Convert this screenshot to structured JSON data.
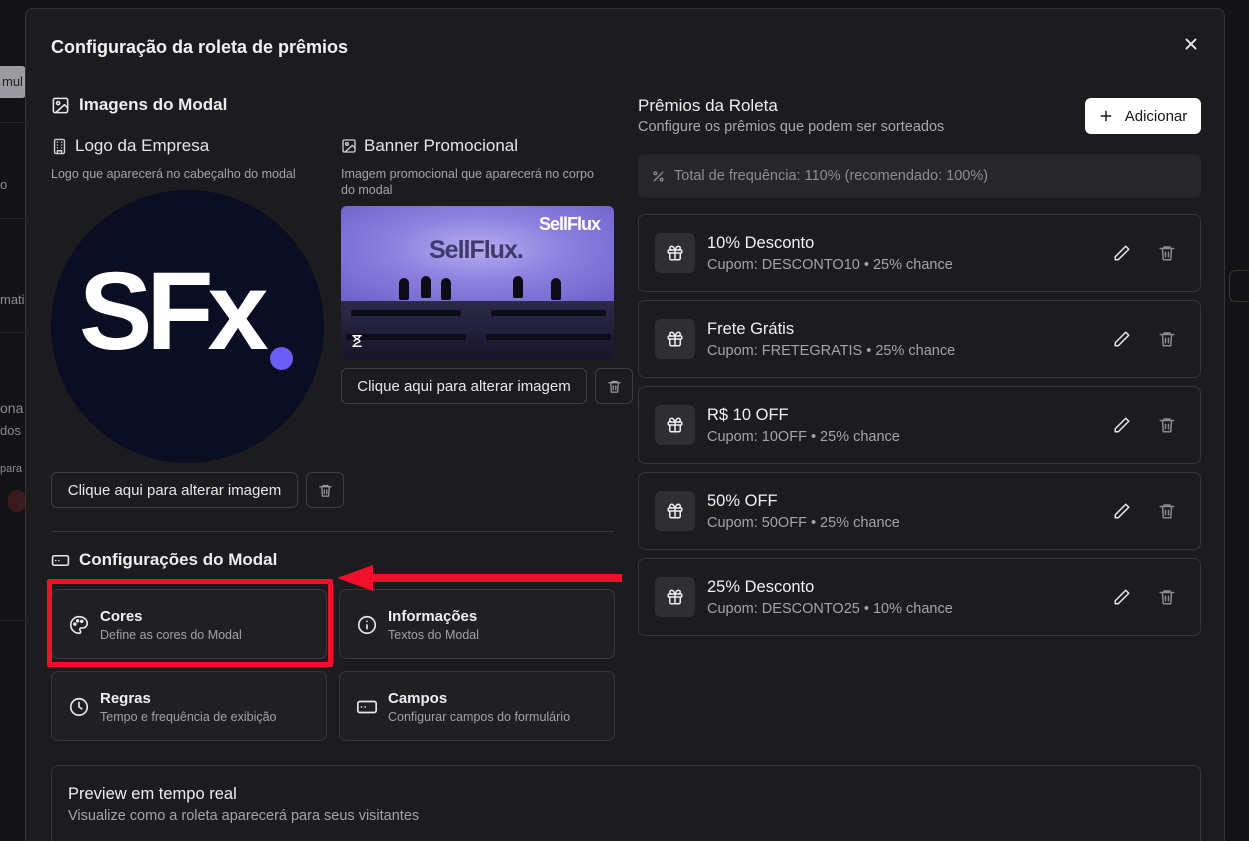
{
  "background": {
    "fragments": [
      "mul",
      "o",
      "mati",
      "ona",
      "dos c",
      "para"
    ]
  },
  "modal": {
    "title": "Configuração da roleta de prêmios",
    "images_section": {
      "title": "Imagens do Modal",
      "logo": {
        "label": "Logo da Empresa",
        "hint": "Logo que aparecerá no cabeçalho do modal",
        "logo_text": "SFx",
        "change_button": "Clique aqui para alterar imagem"
      },
      "banner": {
        "label": "Banner Promocional",
        "hint": "Imagem promocional que aparecerá no corpo do modal",
        "brand_top": "SellFlux",
        "brand_wall": "SellFlux.",
        "change_button": "Clique aqui para alterar imagem"
      }
    },
    "config_section": {
      "title": "Configurações do Modal",
      "cards": [
        {
          "title": "Cores",
          "desc": "Define as cores do Modal",
          "icon": "palette-icon"
        },
        {
          "title": "Informações",
          "desc": "Textos do Modal",
          "icon": "info-icon"
        },
        {
          "title": "Regras",
          "desc": "Tempo e frequência de exibição",
          "icon": "clock-icon"
        },
        {
          "title": "Campos",
          "desc": "Configurar campos do formulário",
          "icon": "form-field-icon"
        }
      ]
    },
    "prizes_section": {
      "title": "Prêmios da Roleta",
      "subtitle": "Configure os prêmios que podem ser sorteados",
      "add_button": "Adicionar",
      "frequency_total": "Total de frequência: 110% (recomendado: 100%)",
      "prizes": [
        {
          "name": "10% Desconto",
          "meta": "Cupom: DESCONTO10 • 25% chance"
        },
        {
          "name": "Frete Grátis",
          "meta": "Cupom: FRETEGRATIS • 25% chance"
        },
        {
          "name": "R$ 10 OFF",
          "meta": "Cupom: 10OFF • 25% chance"
        },
        {
          "name": "50% OFF",
          "meta": "Cupom: 50OFF • 25% chance"
        },
        {
          "name": "25% Desconto",
          "meta": "Cupom: DESCONTO25 • 10% chance"
        }
      ]
    },
    "preview": {
      "title": "Preview em tempo real",
      "desc": "Visualize como a roleta aparecerá para seus visitantes"
    }
  },
  "colors": {
    "highlight": "#f0102a",
    "logo_bg": "#0b0d22",
    "logo_dot": "#6b5cf6"
  }
}
